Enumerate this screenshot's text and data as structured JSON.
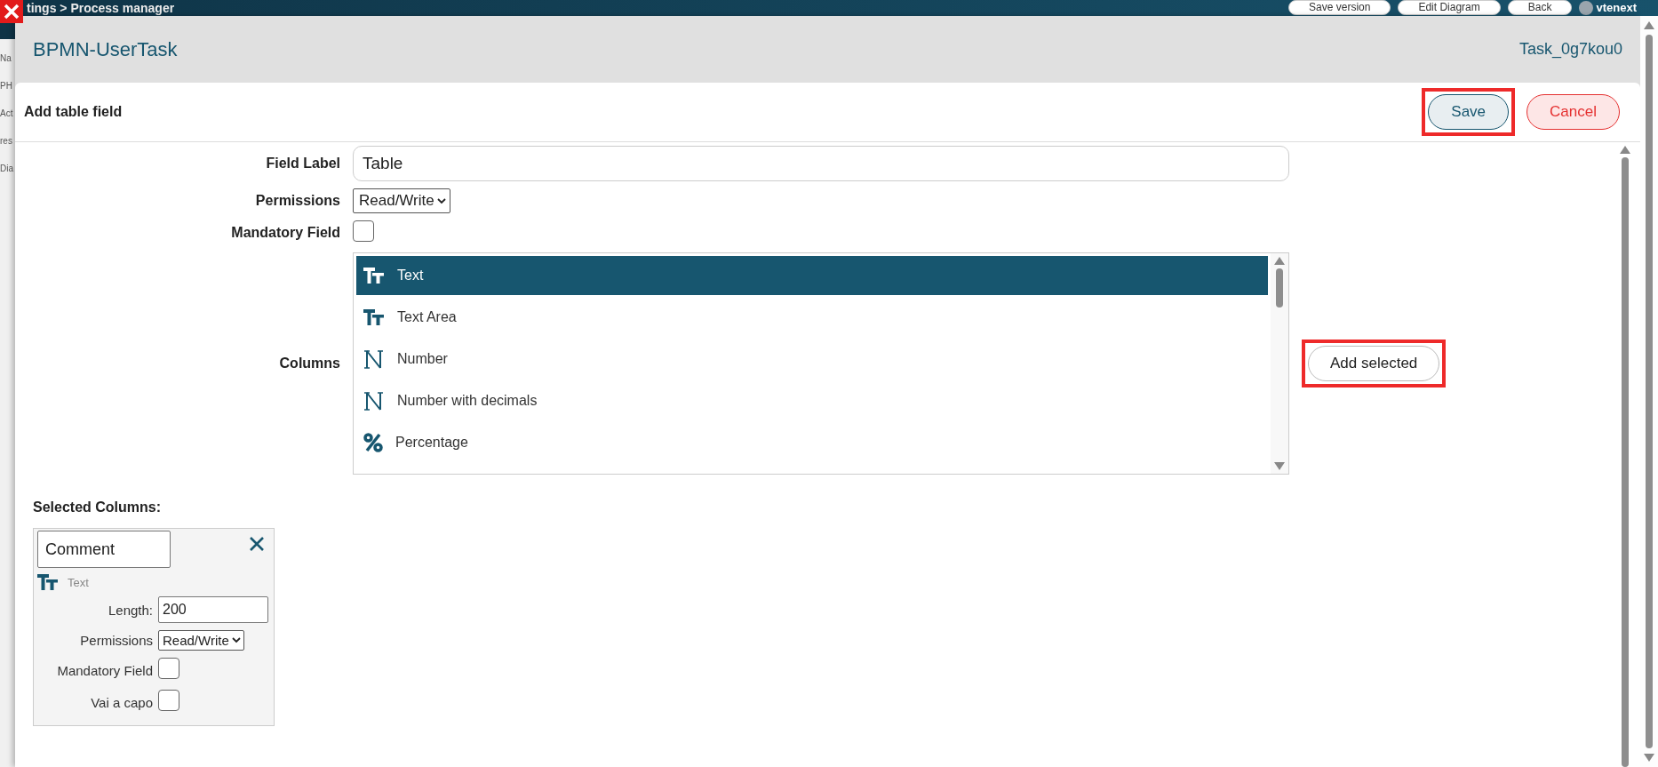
{
  "background": {
    "breadcrumb": "tings > Process manager",
    "buttons": [
      "Save version",
      "Edit Diagram",
      "Back"
    ],
    "brand": "vtenext",
    "side_labels": [
      "Na",
      "PH",
      "Act",
      "res",
      "Dia"
    ]
  },
  "dialog": {
    "title": "BPMN-UserTask",
    "task_id": "Task_0g7kou0"
  },
  "panel": {
    "title": "Add table field",
    "buttons": [
      {
        "label": "Save",
        "kind": "primary",
        "highlighted": true
      },
      {
        "label": "Cancel",
        "kind": "danger",
        "highlighted": false
      }
    ]
  },
  "form": {
    "field_label": {
      "label": "Field Label",
      "value": "Table"
    },
    "permissions": {
      "label": "Permissions",
      "value": "Read/Write"
    },
    "mandatory": {
      "label": "Mandatory Field",
      "checked": false
    },
    "columns": {
      "label": "Columns",
      "options": [
        {
          "label": "Text",
          "kind": "text",
          "selected": true
        },
        {
          "label": "Text Area",
          "kind": "text",
          "selected": false
        },
        {
          "label": "Number",
          "kind": "number",
          "selected": false
        },
        {
          "label": "Number with decimals",
          "kind": "number",
          "selected": false
        },
        {
          "label": "Percentage",
          "kind": "percentage",
          "selected": false
        }
      ],
      "add_button": {
        "label": "Add selected",
        "highlighted": true
      }
    }
  },
  "selected_columns": {
    "title": "Selected Columns:",
    "items": [
      {
        "name": "Comment",
        "type_label": "Text",
        "kind": "text",
        "length_label": "Length:",
        "length": "200",
        "permissions_label": "Permissions",
        "permissions": "Read/Write",
        "mandatory_label": "Mandatory Field",
        "mandatory": false,
        "wrap_label": "Vai a capo",
        "wrap": false
      }
    ]
  }
}
